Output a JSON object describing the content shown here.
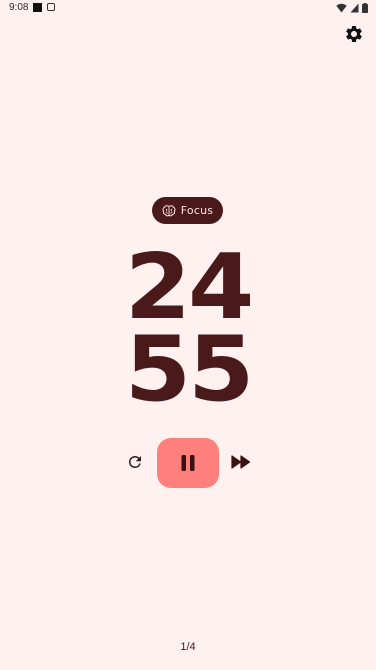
{
  "status_bar": {
    "time": "9:08",
    "icons": [
      "notification-square-icon",
      "app-notification-icon",
      "wifi-icon",
      "cellular-icon",
      "battery-icon"
    ]
  },
  "header": {
    "settings_icon": "gear-icon"
  },
  "mode_chip": {
    "icon": "brain-icon",
    "label": "Focus"
  },
  "timer": {
    "minutes": "24",
    "seconds": "55"
  },
  "controls": {
    "reset_icon": "reset-icon",
    "pause_icon": "pause-icon",
    "skip_icon": "fast-forward-icon"
  },
  "page_indicator": "1/4",
  "colors": {
    "background": "#fff1f0",
    "primary": "#4a1919",
    "accent": "#ff7f7d",
    "chip_text": "#ffe3e0"
  }
}
